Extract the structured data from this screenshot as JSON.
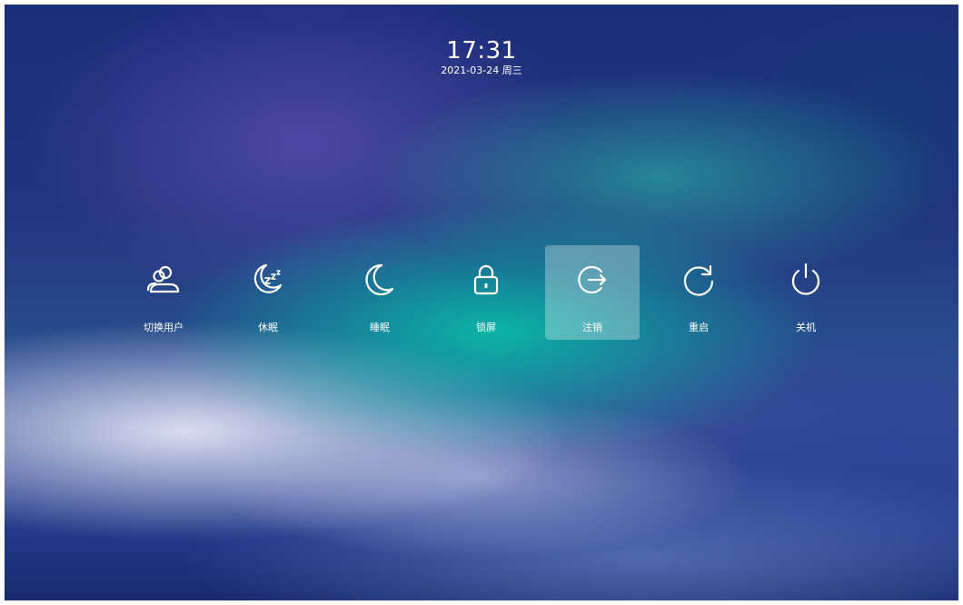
{
  "clock": {
    "time": "17:31",
    "date": "2021-03-24 周三"
  },
  "actions": [
    {
      "label": "切换用户",
      "icon": "switch-user-icon"
    },
    {
      "label": "休眠",
      "icon": "hibernate-icon"
    },
    {
      "label": "睡眠",
      "icon": "sleep-moon-icon"
    },
    {
      "label": "锁屏",
      "icon": "lock-icon"
    },
    {
      "label": "注销",
      "icon": "logout-icon",
      "selected": true
    },
    {
      "label": "重启",
      "icon": "restart-icon"
    },
    {
      "label": "关机",
      "icon": "power-icon"
    }
  ],
  "colors": {
    "text": "#ffffff",
    "selected_bg": "rgba(255,255,255,0.30)"
  }
}
